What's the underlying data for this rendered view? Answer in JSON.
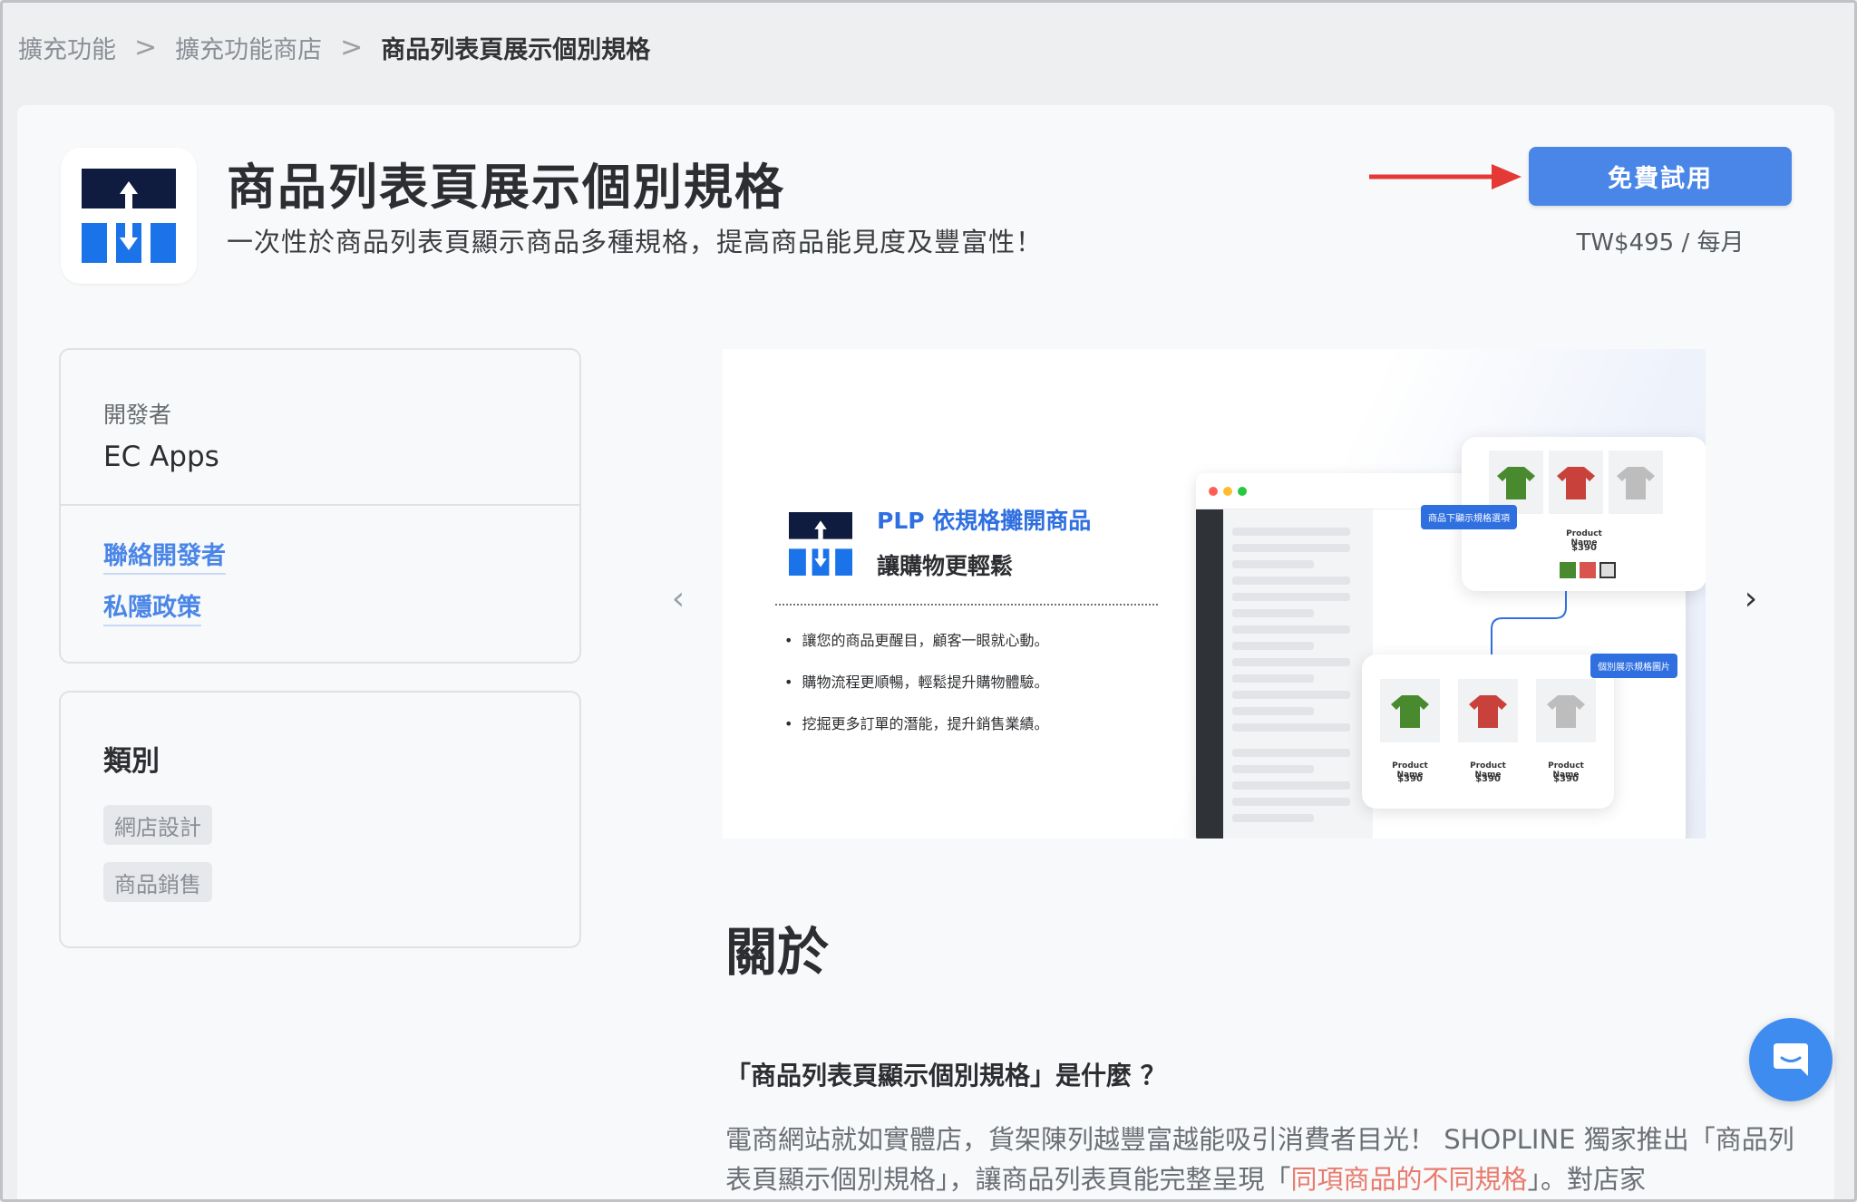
{
  "breadcrumb": {
    "items": [
      "擴充功能",
      "擴充功能商店"
    ],
    "separator": ">",
    "current": "商品列表頁展示個別規格"
  },
  "header": {
    "title": "商品列表頁展示個別規格",
    "tagline": "一次性於商品列表頁顯示商品多種規格，提高商品能見度及豐富性！",
    "trial_button": "免費試用",
    "price": "TW$495 / 每月",
    "accent_color": "#4a86e8",
    "arrow_color": "#e53935"
  },
  "developer": {
    "label": "開發者",
    "name": "EC Apps",
    "contact_link": "聯絡開發者",
    "privacy_link": "私隱政策"
  },
  "category": {
    "title": "類別",
    "tags": [
      "網店設計",
      "商品銷售"
    ]
  },
  "carousel": {
    "prev_icon": "‹",
    "next_icon": "›",
    "slide": {
      "heading_blue": "PLP 依規格攤開商品",
      "heading_dark": "讓購物更輕鬆",
      "bullets": [
        "讓您的商品更醒目，顧客一眼就心動。",
        "購物流程更順暢，輕鬆提升購物體驗。",
        "挖掘更多訂單的潛能，提升銷售業績。"
      ],
      "label_variant_option": "商品下顯示規格選項",
      "label_variant_image": "個別展示規格圖片",
      "product_name": "Product Name",
      "product_price": "$390"
    }
  },
  "about": {
    "title": "關於",
    "faq_title": "「商品列表頁顯示個別規格」是什麼 ？",
    "body_before": "電商網站就如實體店，貨架陳列越豐富越能吸引消費者目光！ SHOPLINE 獨家推出「商品列表頁顯示個別規格」，讓商品列表頁能完整呈現「",
    "body_highlight": "同項商品的不同規格",
    "body_after": "」。對店家"
  }
}
